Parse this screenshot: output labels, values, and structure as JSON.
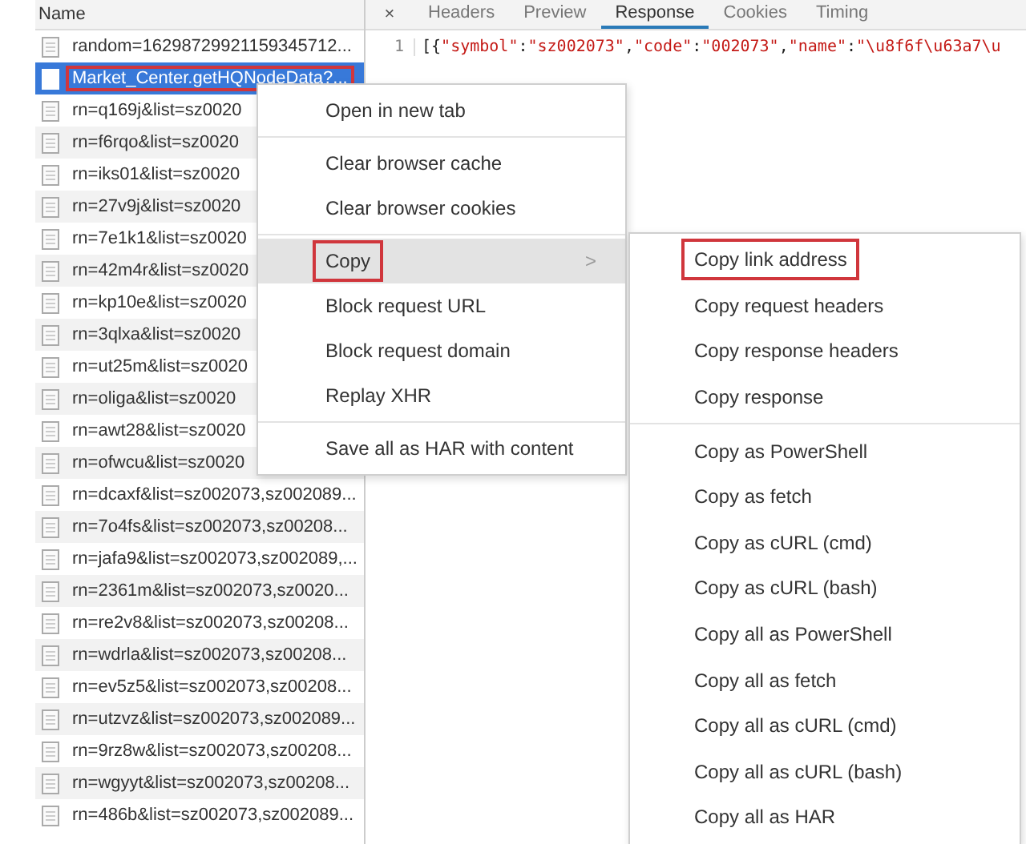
{
  "requests": {
    "column": "Name",
    "rows": [
      {
        "name": "random=16298729921159345712...",
        "selected": false,
        "highlighted": false
      },
      {
        "name": "Market_Center.getHQNodeData?...",
        "selected": true,
        "highlighted": true
      },
      {
        "name": "rn=q169j&list=sz0020",
        "selected": false,
        "highlighted": false
      },
      {
        "name": "rn=f6rqo&list=sz0020",
        "selected": false,
        "highlighted": false
      },
      {
        "name": "rn=iks01&list=sz0020",
        "selected": false,
        "highlighted": false
      },
      {
        "name": "rn=27v9j&list=sz0020",
        "selected": false,
        "highlighted": false
      },
      {
        "name": "rn=7e1k1&list=sz0020",
        "selected": false,
        "highlighted": false
      },
      {
        "name": "rn=42m4r&list=sz0020",
        "selected": false,
        "highlighted": false
      },
      {
        "name": "rn=kp10e&list=sz0020",
        "selected": false,
        "highlighted": false
      },
      {
        "name": "rn=3qlxa&list=sz0020",
        "selected": false,
        "highlighted": false
      },
      {
        "name": "rn=ut25m&list=sz0020",
        "selected": false,
        "highlighted": false
      },
      {
        "name": "rn=oliga&list=sz0020",
        "selected": false,
        "highlighted": false
      },
      {
        "name": "rn=awt28&list=sz0020",
        "selected": false,
        "highlighted": false
      },
      {
        "name": "rn=ofwcu&list=sz0020",
        "selected": false,
        "highlighted": false
      },
      {
        "name": "rn=dcaxf&list=sz002073,sz002089...",
        "selected": false,
        "highlighted": false
      },
      {
        "name": "rn=7o4fs&list=sz002073,sz00208...",
        "selected": false,
        "highlighted": false
      },
      {
        "name": "rn=jafa9&list=sz002073,sz002089,...",
        "selected": false,
        "highlighted": false
      },
      {
        "name": "rn=2361m&list=sz002073,sz0020...",
        "selected": false,
        "highlighted": false
      },
      {
        "name": "rn=re2v8&list=sz002073,sz00208...",
        "selected": false,
        "highlighted": false
      },
      {
        "name": "rn=wdrla&list=sz002073,sz00208...",
        "selected": false,
        "highlighted": false
      },
      {
        "name": "rn=ev5z5&list=sz002073,sz00208...",
        "selected": false,
        "highlighted": false
      },
      {
        "name": "rn=utzvz&list=sz002073,sz002089...",
        "selected": false,
        "highlighted": false
      },
      {
        "name": "rn=9rz8w&list=sz002073,sz00208...",
        "selected": false,
        "highlighted": false
      },
      {
        "name": "rn=wgyyt&list=sz002073,sz00208...",
        "selected": false,
        "highlighted": false
      },
      {
        "name": "rn=486b&list=sz002073,sz002089...",
        "selected": false,
        "highlighted": false
      }
    ]
  },
  "detail": {
    "close": "×",
    "tabs": [
      {
        "label": "Headers",
        "selected": false
      },
      {
        "label": "Preview",
        "selected": false
      },
      {
        "label": "Response",
        "selected": true
      },
      {
        "label": "Cookies",
        "selected": false
      },
      {
        "label": "Timing",
        "selected": false
      }
    ],
    "line_number": "1",
    "code": [
      {
        "kind": "punct",
        "text": "[{"
      },
      {
        "kind": "string",
        "text": "\"symbol\""
      },
      {
        "kind": "punct",
        "text": ":"
      },
      {
        "kind": "string",
        "text": "\"sz002073\""
      },
      {
        "kind": "punct",
        "text": ","
      },
      {
        "kind": "string",
        "text": "\"code\""
      },
      {
        "kind": "punct",
        "text": ":"
      },
      {
        "kind": "string",
        "text": "\"002073\""
      },
      {
        "kind": "punct",
        "text": ","
      },
      {
        "kind": "string",
        "text": "\"name\""
      },
      {
        "kind": "punct",
        "text": ":"
      },
      {
        "kind": "string",
        "text": "\"\\u8f6f\\u63a7\\u"
      }
    ]
  },
  "context_menu": {
    "groups": [
      [
        {
          "label": "Open in new tab",
          "hovered": false,
          "highlighted": false
        }
      ],
      [
        {
          "label": "Clear browser cache",
          "hovered": false,
          "highlighted": false
        },
        {
          "label": "Clear browser cookies",
          "hovered": false,
          "highlighted": false
        }
      ],
      [
        {
          "label": "Copy",
          "hovered": true,
          "highlighted": true,
          "arrow": ">"
        },
        {
          "label": "Block request URL",
          "hovered": false,
          "highlighted": false
        },
        {
          "label": "Block request domain",
          "hovered": false,
          "highlighted": false
        },
        {
          "label": "Replay XHR",
          "hovered": false,
          "highlighted": false
        }
      ],
      [
        {
          "label": "Save all as HAR with content",
          "hovered": false,
          "highlighted": false
        }
      ]
    ]
  },
  "submenu": {
    "groups": [
      [
        {
          "label": "Copy link address",
          "highlighted": true
        },
        {
          "label": "Copy request headers",
          "highlighted": false
        },
        {
          "label": "Copy response headers",
          "highlighted": false
        },
        {
          "label": "Copy response",
          "highlighted": false
        }
      ],
      [
        {
          "label": "Copy as PowerShell",
          "highlighted": false
        },
        {
          "label": "Copy as fetch",
          "highlighted": false
        },
        {
          "label": "Copy as cURL (cmd)",
          "highlighted": false
        },
        {
          "label": "Copy as cURL (bash)",
          "highlighted": false
        },
        {
          "label": "Copy all as PowerShell",
          "highlighted": false
        },
        {
          "label": "Copy all as fetch",
          "highlighted": false
        },
        {
          "label": "Copy all as cURL (cmd)",
          "highlighted": false
        },
        {
          "label": "Copy all as cURL (bash)",
          "highlighted": false
        },
        {
          "label": "Copy all as HAR",
          "highlighted": false
        }
      ]
    ]
  }
}
